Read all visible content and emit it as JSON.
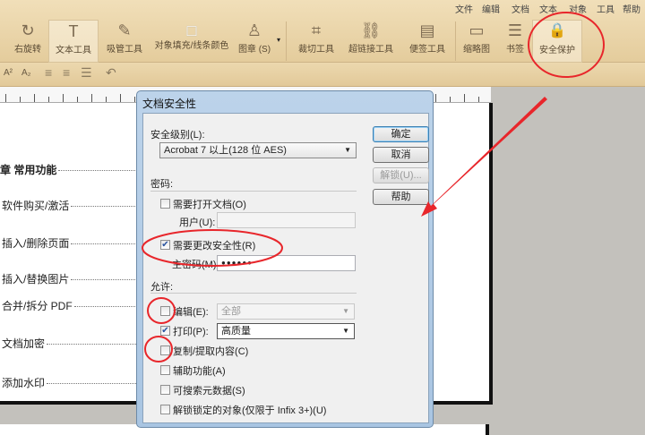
{
  "menu": [
    "文件",
    "编辑",
    "文档",
    "文本",
    "对象",
    "工具",
    "帮助"
  ],
  "tools": [
    {
      "label": "右旋转",
      "icon": "rotate-right-icon",
      "glyph": "↻"
    },
    {
      "label": "文本工具",
      "icon": "text-tool-icon",
      "glyph": "T"
    },
    {
      "label": "吸管工具",
      "icon": "eyedropper-icon",
      "glyph": "✎"
    },
    {
      "label": "对象填充/线条颜色",
      "icon": "fill-color-icon",
      "glyph": "□"
    },
    {
      "label": "图章 (S)",
      "icon": "stamp-icon",
      "glyph": "♙"
    },
    {
      "label": "裁切工具",
      "icon": "crop-icon",
      "glyph": "⌗"
    },
    {
      "label": "超链接工具",
      "icon": "link-icon",
      "glyph": "⛓"
    },
    {
      "label": "便签工具",
      "icon": "note-icon",
      "glyph": "▤"
    },
    {
      "label": "缩略图",
      "icon": "thumbnail-icon",
      "glyph": "▭"
    },
    {
      "label": "书签",
      "icon": "bookmark-list-icon",
      "glyph": "☰"
    },
    {
      "label": "安全保护",
      "icon": "lock-icon",
      "glyph": "🔒"
    }
  ],
  "format": {
    "superscript": "A²",
    "subscript": "A₂"
  },
  "toc": [
    "章  常用功能",
    "软件购买/激活",
    "插入/删除页面",
    "插入/替换图片",
    "合并/拆分 PDF",
    "文档加密",
    "添加水印"
  ],
  "dialog": {
    "title": "文档安全性",
    "level_label": "安全级别(L):",
    "level_value": "Acrobat 7 以上(128 位 AES)",
    "ok": "确定",
    "cancel": "取消",
    "unlock": "解锁(U)...",
    "help": "帮助",
    "password_section": "密码:",
    "require_open": {
      "label": "需要打开文档(O)",
      "checked": false
    },
    "user_label": "用户(U):",
    "user_value": "",
    "require_change": {
      "label": "需要更改安全性(R)",
      "checked": true
    },
    "master_label": "主密码(M):",
    "master_value": "●●●●●●",
    "allow_section": "允许:",
    "edit": {
      "label": "编辑(E):",
      "checked": false,
      "value": "全部"
    },
    "print": {
      "label": "打印(P):",
      "checked": true,
      "value": "高质量"
    },
    "copy": {
      "label": "复制/提取内容(C)",
      "checked": false
    },
    "accessibility": {
      "label": "辅助功能(A)",
      "checked": false
    },
    "metadata": {
      "label": "可搜索元数据(S)",
      "checked": false
    },
    "unlock_objects": {
      "label": "解锁锁定的对象(仅限于 Infix 3+)(U)",
      "checked": false
    }
  },
  "annotation_color": "#e8262b"
}
